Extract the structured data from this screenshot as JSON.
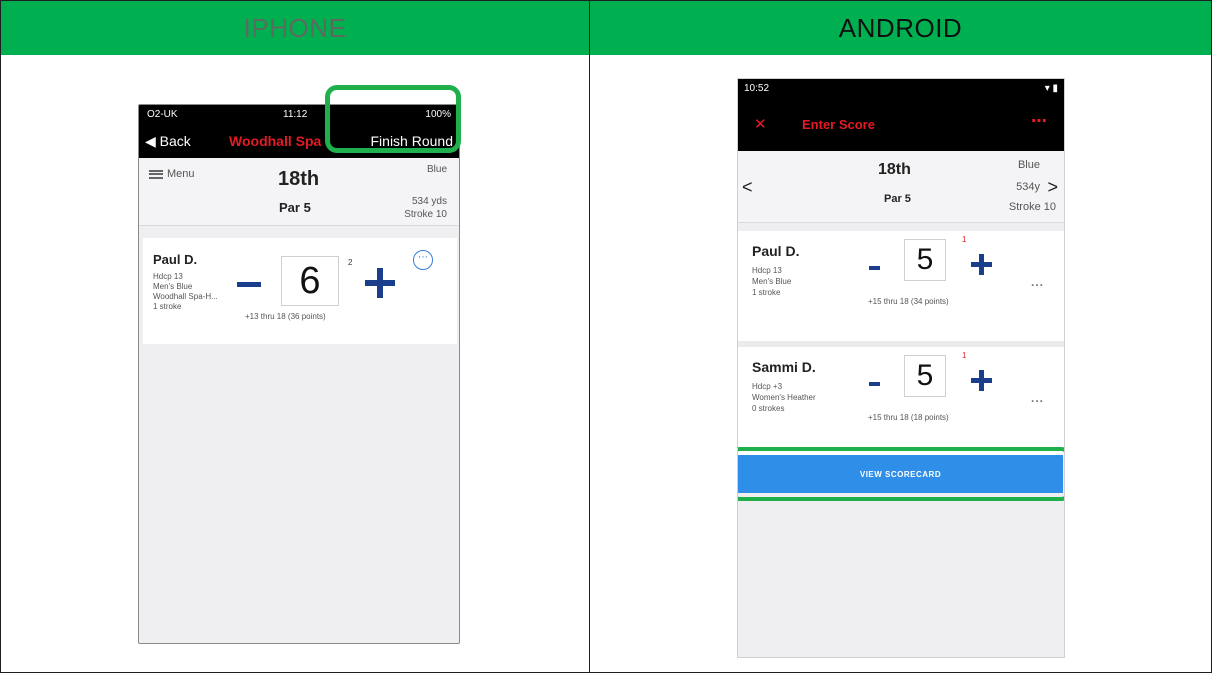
{
  "table": {
    "left_header": "IPHONE",
    "right_header": "ANDROID"
  },
  "iphone": {
    "status": {
      "carrier": "O2-UK",
      "time": "11:12",
      "battery": "100%"
    },
    "nav": {
      "back_label": "Back",
      "title": "Woodhall Spa",
      "finish_label": "Finish Round"
    },
    "hole": {
      "menu_label": "Menu",
      "hole": "18th",
      "par": "Par 5",
      "tee": "Blue",
      "yardage": "534 yds",
      "stroke_index": "Stroke 10"
    },
    "player": {
      "name": "Paul D.",
      "details": [
        "Hdcp 13",
        "Men's Blue",
        "Woodhall Spa-H...",
        "1 stroke"
      ],
      "score": "6",
      "stroke_marker": "2",
      "summary": "+13 thru 18 (36 points)",
      "minus_label": "-",
      "plus_label": "+",
      "more_label": "⋯"
    }
  },
  "android": {
    "status": {
      "time": "10:52"
    },
    "nav": {
      "close_label": "✕",
      "title": "Enter Score",
      "more_label": "⋯"
    },
    "hole": {
      "prev_label": "<",
      "next_label": ">",
      "hole": "18th",
      "par": "Par 5",
      "tee": "Blue",
      "yardage": "534y",
      "stroke_index": "Stroke 10"
    },
    "players": [
      {
        "name": "Paul D.",
        "details": [
          "Hdcp 13",
          "Men's Blue",
          "1 stroke"
        ],
        "score": "5",
        "stroke_marker": "1",
        "summary": "+15 thru 18 (34 points)",
        "minus_label": "-",
        "plus_label": "+",
        "more_label": "..."
      },
      {
        "name": "Sammi D.",
        "details": [
          "Hdcp +3",
          "Women's Heather",
          "0 strokes"
        ],
        "score": "5",
        "stroke_marker": "1",
        "summary": "+15 thru 18 (18 points)",
        "minus_label": "-",
        "plus_label": "+",
        "more_label": "..."
      }
    ],
    "view_scorecard_label": "VIEW SCORECARD"
  },
  "colors": {
    "header_green": "#00b050",
    "highlight_green": "#20b04b",
    "brand_red": "#e31b23",
    "stepper_blue": "#1a3e8c",
    "button_blue": "#2f8fe8"
  },
  "icons": [
    "hamburger-icon",
    "back-chevron-icon",
    "close-icon",
    "more-dots-icon",
    "prev-chevron-icon",
    "next-chevron-icon"
  ]
}
